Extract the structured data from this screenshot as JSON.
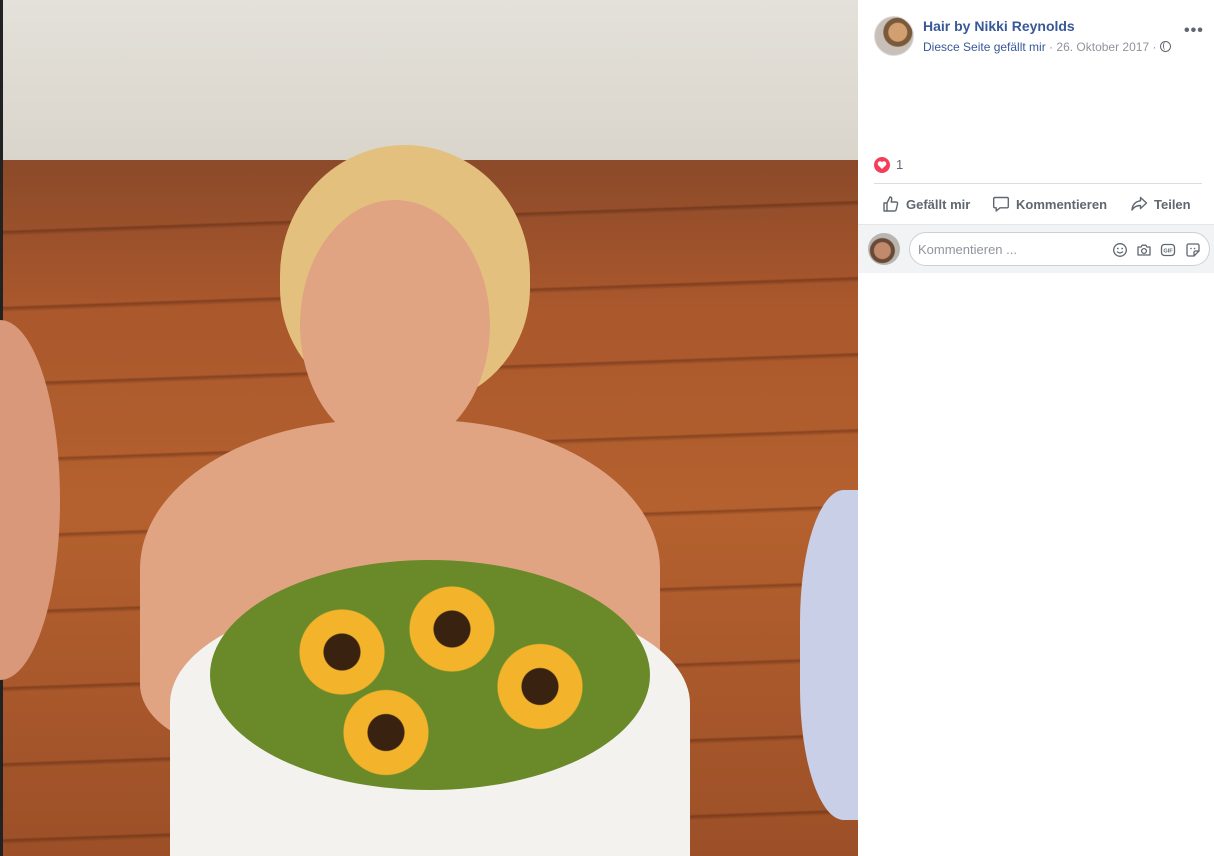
{
  "post": {
    "page_name": "Hair by Nikki Reynolds",
    "like_page": "Diesce Seite gefällt mir",
    "separator1": " · ",
    "date": "26. Oktober 2017",
    "separator2": " · ",
    "more": "•••"
  },
  "reactions": {
    "count": "1"
  },
  "actions": {
    "like": "Gefällt mir",
    "comment": "Kommentieren",
    "share": "Teilen"
  },
  "comment_input": {
    "placeholder": "Kommentieren ..."
  },
  "icons": {
    "privacy": "globe-icon",
    "reaction": "heart-icon",
    "like": "thumbs-up-icon",
    "comment": "speech-bubble-icon",
    "share": "share-arrow-icon",
    "emoji": "smiley-icon",
    "photo": "camera-icon",
    "gif": "gif-icon",
    "sticker": "sticker-icon"
  },
  "colors": {
    "link": "#385898",
    "heart": "#f33e58",
    "muted": "#606770"
  }
}
